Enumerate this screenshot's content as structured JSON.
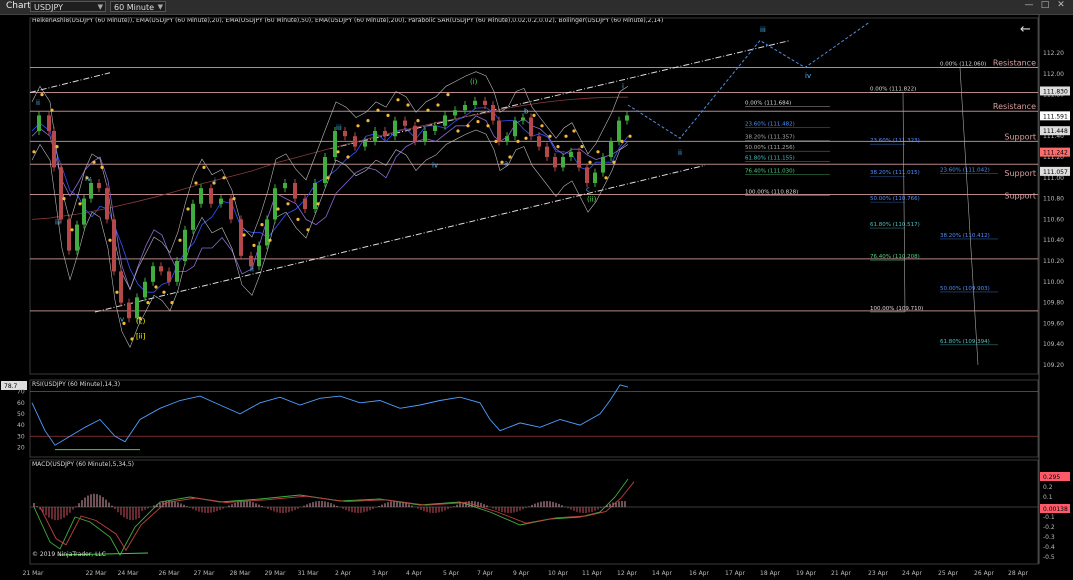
{
  "toolbar": {
    "chart_tab": "Chart",
    "instrument": "USDJPY",
    "timeframe": "60 Minute"
  },
  "indicators_line": "HeikenAshi8(USDJPY (60 Minute)), EMA(USDJPY (60 Minute),20), EMA(USDJPY (60 Minute),50), EMA(USDJPY (60 Minute),200), Parabolic SAR(USDJPY (60 Minute),0.02,0.2,0.02), Bollinger(USDJPY (60 Minute),2,14)",
  "copyright": "© 2019 NinjaTrader, LLC",
  "chart_data": {
    "type": "line",
    "price_axis": {
      "labels": [
        "112.20",
        "112.00",
        "111.80",
        "111.60",
        "111.40",
        "111.20",
        "111.00",
        "110.80",
        "110.60",
        "110.40",
        "110.20",
        "110.00",
        "109.80",
        "109.60",
        "109.40",
        "109.20"
      ],
      "ylim": [
        109.1,
        112.3
      ]
    },
    "price_badges": [
      {
        "label": "111.830",
        "value": 111.83,
        "color": "#dddddd"
      },
      {
        "label": "111.591",
        "value": 111.591,
        "color": "#ffffff"
      },
      {
        "label": "111.448",
        "value": 111.448,
        "color": "#dddddd"
      },
      {
        "label": "111.242",
        "value": 111.242,
        "color": "#ff6b6b"
      },
      {
        "label": "111.057",
        "value": 111.057,
        "color": "#dddddd"
      }
    ],
    "x_labels": [
      "21 Mar",
      "22 Mar",
      "24 Mar",
      "26 Mar",
      "27 Mar",
      "28 Mar",
      "29 Mar",
      "31 Mar",
      "2 Apr",
      "3 Apr",
      "4 Apr",
      "5 Apr",
      "7 Apr",
      "9 Apr",
      "10 Apr",
      "11 Apr",
      "12 Apr",
      "14 Apr",
      "16 Apr",
      "17 Apr",
      "18 Apr",
      "19 Apr",
      "21 Apr",
      "23 Apr",
      "24 Apr",
      "25 Apr",
      "26 Apr",
      "28 Apr"
    ],
    "horizontal_levels": [
      112.06,
      111.82,
      111.64,
      111.35,
      111.13,
      110.84,
      110.22,
      109.72
    ],
    "level_labels": [
      {
        "text": "Resistance",
        "value": 112.06
      },
      {
        "text": "Resistance",
        "value": 111.64
      },
      {
        "text": "Support",
        "value": 111.35
      },
      {
        "text": "Support",
        "value": 111.0
      },
      {
        "text": "Support",
        "value": 110.78
      }
    ],
    "fib_sets": [
      {
        "levels": [
          {
            "text": "0.00% (111.684)",
            "value": 111.684,
            "color": "#dddddd"
          },
          {
            "text": "23.60% (111.482)",
            "value": 111.482,
            "color": "#4f8fff"
          },
          {
            "text": "38.20% (111.357)",
            "value": 111.357,
            "color": "#aaaaaa"
          },
          {
            "text": "50.00% (111.256)",
            "value": 111.256,
            "color": "#aaaaaa"
          },
          {
            "text": "61.80% (111.155)",
            "value": 111.155,
            "color": "#4fc0c0"
          },
          {
            "text": "76.40% (111.030)",
            "value": 111.03,
            "color": "#4fd080"
          },
          {
            "text": "100.00% (110.828)",
            "value": 110.828,
            "color": "#dddddd"
          }
        ]
      },
      {
        "levels": [
          {
            "text": "0.00% (111.822)",
            "value": 111.822,
            "color": "#dddddd"
          },
          {
            "text": "23.60% (111.323)",
            "value": 111.323,
            "color": "#4f8fff"
          },
          {
            "text": "38.20% (111.015)",
            "value": 111.015,
            "color": "#4f8fff"
          },
          {
            "text": "50.00% (110.766)",
            "value": 110.766,
            "color": "#4f8fff"
          },
          {
            "text": "61.80% (110.517)",
            "value": 110.517,
            "color": "#4fc0c0"
          },
          {
            "text": "76.40% (110.208)",
            "value": 110.208,
            "color": "#4fd080"
          },
          {
            "text": "100.00% (109.710)",
            "value": 109.71,
            "color": "#dddddd"
          }
        ]
      },
      {
        "levels": [
          {
            "text": "0.00% (112.060)",
            "value": 112.06,
            "color": "#dddddd"
          },
          {
            "text": "23.60% (111.042)",
            "value": 111.042,
            "color": "#4f8fff"
          },
          {
            "text": "38.20% (110.412)",
            "value": 110.412,
            "color": "#4f8fff"
          },
          {
            "text": "50.00% (109.903)",
            "value": 109.903,
            "color": "#4f8fff"
          },
          {
            "text": "61.80% (109.394)",
            "value": 109.394,
            "color": "#4fc0c0"
          }
        ]
      }
    ],
    "wave_labels": [
      {
        "text": "ii",
        "color": "#4fc0ff"
      },
      {
        "text": "iii",
        "color": "#4fc0ff"
      },
      {
        "text": "iv",
        "color": "#4fc0ff"
      },
      {
        "text": "v",
        "color": "#4fc0ff"
      },
      {
        "text": "(c)",
        "color": "#ffff00"
      },
      {
        "text": "[ii]",
        "color": "#ffff00"
      },
      {
        "text": "i",
        "color": "#4fc0ff"
      },
      {
        "text": "ii",
        "color": "#4fc0ff"
      },
      {
        "text": "iii",
        "color": "#4fc0ff"
      },
      {
        "text": "iv",
        "color": "#4fc0ff"
      },
      {
        "text": "(i)",
        "color": "#4fe04f"
      },
      {
        "text": "b",
        "color": "#4fc0ff"
      },
      {
        "text": "a",
        "color": "#4fc0ff"
      },
      {
        "text": "c",
        "color": "#4fc0ff"
      },
      {
        "text": "(ii)",
        "color": "#4fe04f"
      },
      {
        "text": "i",
        "color": "#4fc0ff"
      },
      {
        "text": "ii",
        "color": "#4fc0ff"
      },
      {
        "text": "iii",
        "color": "#4fc0ff"
      },
      {
        "text": "iv",
        "color": "#4fc0ff"
      }
    ],
    "rsi": {
      "title": "RSI(USDJPY (60 Minute),14,3)",
      "value_badge": "78.7",
      "axis": [
        "70",
        "60",
        "50",
        "40",
        "30",
        "20"
      ],
      "upper": 70,
      "lower": 30
    },
    "macd": {
      "title": "MACD(USDJPY (60 Minute),5,34,5)",
      "badges": [
        "0.295",
        "0.00138"
      ],
      "axis": [
        "0.2",
        "0.1",
        "0",
        "-0.1",
        "-0.2",
        "-0.3",
        "-0.4",
        "-0.5"
      ]
    }
  }
}
